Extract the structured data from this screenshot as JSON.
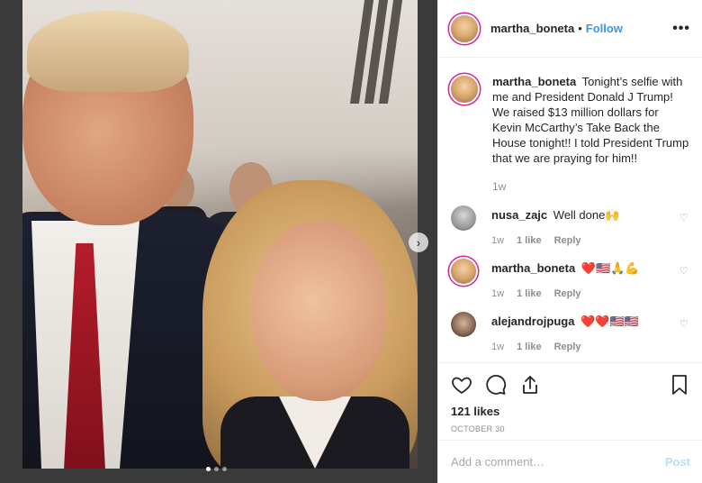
{
  "post": {
    "author": "martha_boneta",
    "follow_label": "Follow",
    "separator": "•",
    "more_label": "•••"
  },
  "photo": {
    "current_index": 1,
    "total": 3
  },
  "caption": {
    "username": "martha_boneta",
    "text": "Tonight’s selfie with me and President Donald J Trump! We raised $13 million dollars for Kevin McCarthy’s Take Back the House tonight!! I told President Trump that we are praying for him!!",
    "time": "1w"
  },
  "comments": [
    {
      "username": "nusa_zajc",
      "text": "Well done🙌",
      "time": "1w",
      "likes": "1 like",
      "reply": "Reply"
    },
    {
      "username": "martha_boneta",
      "text": "❤️🇺🇸🙏💪",
      "time": "1w",
      "likes": "1 like",
      "reply": "Reply"
    },
    {
      "username": "alejandrojpuga",
      "text": "❤️❤️🇺🇸🇺🇸",
      "time": "1w",
      "likes": "1 like",
      "reply": "Reply"
    }
  ],
  "actions": {
    "likes": "121 likes",
    "date": "OCTOBER 30"
  },
  "add_comment": {
    "placeholder": "Add a comment…",
    "post_label": "Post"
  },
  "colors": {
    "link_blue": "#3897f0",
    "post_disabled": "#b2dffc",
    "muted": "#8e8e8e",
    "story_ring": "#d6249f"
  }
}
